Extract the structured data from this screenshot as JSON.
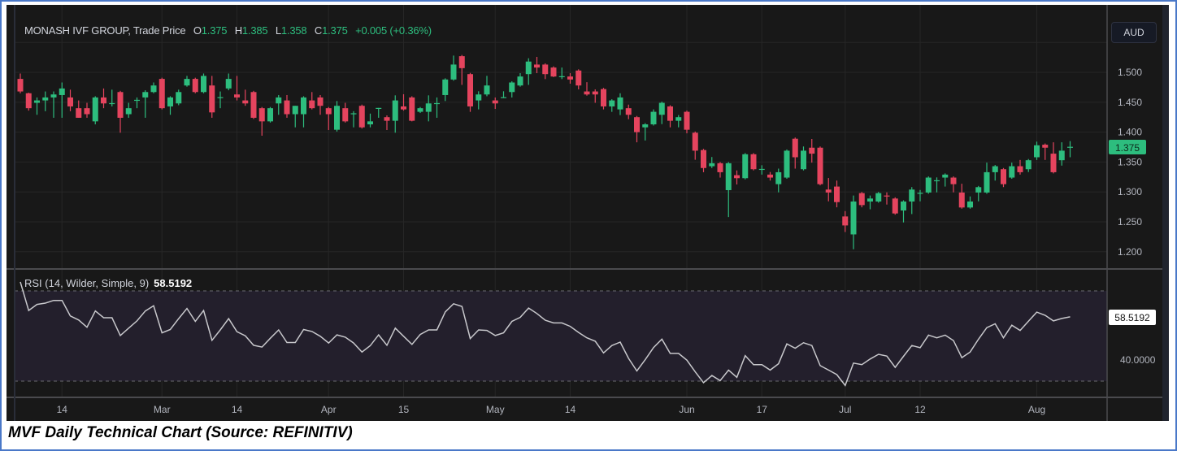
{
  "legend": {
    "symbol": "MONASH IVF GROUP, Trade Price",
    "o_label": "O",
    "o_value": "1.375",
    "h_label": "H",
    "h_value": "1.385",
    "l_label": "L",
    "l_value": "1.358",
    "c_label": "C",
    "c_value": "1.375",
    "change": "+0.005 (+0.36%)"
  },
  "currency_button": "AUD",
  "rsi_legend": {
    "label": "RSI (14, Wilder, Simple, 9)",
    "value": "58.5192"
  },
  "caption": "MVF Daily Technical Chart (Source: REFINITIV)",
  "colors": {
    "up": "#2dbd7e",
    "down": "#e5445e",
    "background": "#181818",
    "rsi_line": "#c8c8cc",
    "rsi_band": "#231f2c"
  },
  "chart_data": [
    {
      "type": "candlestick",
      "title": "MONASH IVF GROUP, Trade Price",
      "ylim": [
        1.16,
        1.56
      ],
      "y_ticks": [
        "1.500",
        "1.450",
        "1.400",
        "1.350",
        "1.300",
        "1.250",
        "1.200"
      ],
      "x_ticks": [
        "14",
        "Mar",
        "14",
        "Apr",
        "15",
        "May",
        "14",
        "Jun",
        "17",
        "Jul",
        "12",
        "Aug"
      ],
      "x_tick_index": [
        5,
        17,
        26,
        37,
        46,
        57,
        66,
        80,
        89,
        99,
        108,
        122
      ],
      "last_price_label": "1.375",
      "ohlc": [
        [
          1.489,
          1.498,
          1.465,
          1.468
        ],
        [
          1.465,
          1.466,
          1.436,
          1.44
        ],
        [
          1.449,
          1.458,
          1.429,
          1.453
        ],
        [
          1.453,
          1.468,
          1.435,
          1.458
        ],
        [
          1.458,
          1.468,
          1.424,
          1.463
        ],
        [
          1.462,
          1.483,
          1.424,
          1.473
        ],
        [
          1.458,
          1.471,
          1.435,
          1.443
        ],
        [
          1.44,
          1.453,
          1.424,
          1.424
        ],
        [
          1.44,
          1.449,
          1.424,
          1.43
        ],
        [
          1.418,
          1.46,
          1.413,
          1.458
        ],
        [
          1.458,
          1.473,
          1.44,
          1.448
        ],
        [
          1.448,
          1.471,
          1.443,
          1.4485
        ],
        [
          1.467,
          1.469,
          1.399,
          1.424
        ],
        [
          1.43,
          1.449,
          1.424,
          1.44
        ],
        [
          1.453,
          1.458,
          1.44,
          1.454
        ],
        [
          1.458,
          1.47,
          1.424,
          1.467
        ],
        [
          1.467,
          1.483,
          1.465,
          1.478
        ],
        [
          1.489,
          1.491,
          1.438,
          1.44
        ],
        [
          1.443,
          1.46,
          1.429,
          1.458
        ],
        [
          1.448,
          1.471,
          1.445,
          1.467
        ],
        [
          1.478,
          1.494,
          1.476,
          1.489
        ],
        [
          1.489,
          1.491,
          1.465,
          1.467
        ],
        [
          1.467,
          1.498,
          1.465,
          1.494
        ],
        [
          1.478,
          1.494,
          1.424,
          1.433
        ],
        [
          1.458,
          1.468,
          1.44,
          1.4585
        ],
        [
          1.473,
          1.498,
          1.47,
          1.489
        ],
        [
          1.463,
          1.494,
          1.453,
          1.458
        ],
        [
          1.453,
          1.471,
          1.444,
          1.448
        ],
        [
          1.467,
          1.469,
          1.422,
          1.424
        ],
        [
          1.44,
          1.442,
          1.394,
          1.418
        ],
        [
          1.418,
          1.442,
          1.416,
          1.44
        ],
        [
          1.448,
          1.462,
          1.429,
          1.458
        ],
        [
          1.453,
          1.462,
          1.424,
          1.43
        ],
        [
          1.43,
          1.444,
          1.408,
          1.444
        ],
        [
          1.43,
          1.46,
          1.408,
          1.458
        ],
        [
          1.453,
          1.467,
          1.438,
          1.44
        ],
        [
          1.458,
          1.462,
          1.429,
          1.444
        ],
        [
          1.44,
          1.442,
          1.4035,
          1.43
        ],
        [
          1.404,
          1.452,
          1.401,
          1.444
        ],
        [
          1.44,
          1.449,
          1.416,
          1.418
        ],
        [
          1.431,
          1.435,
          1.408,
          1.4315
        ],
        [
          1.444,
          1.446,
          1.406,
          1.408
        ],
        [
          1.413,
          1.431,
          1.408,
          1.418
        ],
        [
          1.44,
          1.4405,
          1.424,
          1.4405
        ],
        [
          1.425,
          1.428,
          1.4035,
          1.419
        ],
        [
          1.419,
          1.4615,
          1.399,
          1.453
        ],
        [
          1.443,
          1.4634,
          1.436,
          1.438
        ],
        [
          1.458,
          1.46,
          1.418,
          1.419
        ],
        [
          1.434,
          1.442,
          1.432,
          1.44
        ],
        [
          1.434,
          1.4615,
          1.418,
          1.448
        ],
        [
          1.448,
          1.458,
          1.424,
          1.4485
        ],
        [
          1.462,
          1.49,
          1.452,
          1.488
        ],
        [
          1.488,
          1.528,
          1.486,
          1.513
        ],
        [
          1.527,
          1.529,
          1.479,
          1.507
        ],
        [
          1.497,
          1.499,
          1.4339,
          1.443
        ],
        [
          1.453,
          1.4683,
          1.438,
          1.463
        ],
        [
          1.463,
          1.4941,
          1.46,
          1.478
        ],
        [
          1.453,
          1.4579,
          1.4388,
          1.448
        ],
        [
          1.458,
          1.4683,
          1.457,
          1.4585
        ],
        [
          1.467,
          1.485,
          1.4579,
          1.483
        ],
        [
          1.478,
          1.4986,
          1.476,
          1.493
        ],
        [
          1.497,
          1.5235,
          1.479,
          1.518
        ],
        [
          1.513,
          1.5258,
          1.4986,
          1.508
        ],
        [
          1.513,
          1.515,
          1.4887,
          1.497
        ],
        [
          1.508,
          1.51,
          1.492,
          1.493
        ],
        [
          1.493,
          1.508,
          1.4887,
          1.4935
        ],
        [
          1.493,
          1.4986,
          1.481,
          1.488
        ],
        [
          1.503,
          1.505,
          1.4715,
          1.478
        ],
        [
          1.468,
          1.4835,
          1.461,
          1.463
        ],
        [
          1.468,
          1.4715,
          1.449,
          1.463
        ],
        [
          1.472,
          1.474,
          1.438,
          1.443
        ],
        [
          1.443,
          1.455,
          1.4339,
          1.453
        ],
        [
          1.438,
          1.465,
          1.4285,
          1.458
        ],
        [
          1.44,
          1.446,
          1.4216,
          1.429
        ],
        [
          1.425,
          1.427,
          1.383,
          1.4
        ],
        [
          1.408,
          1.415,
          1.386,
          1.413
        ],
        [
          1.413,
          1.438,
          1.411,
          1.434
        ],
        [
          1.429,
          1.451,
          1.4134,
          1.449
        ],
        [
          1.443,
          1.445,
          1.408,
          1.419
        ],
        [
          1.419,
          1.4285,
          1.408,
          1.425
        ],
        [
          1.434,
          1.436,
          1.398,
          1.404
        ],
        [
          1.399,
          1.401,
          1.3538,
          1.369
        ],
        [
          1.37,
          1.372,
          1.333,
          1.34
        ],
        [
          1.343,
          1.3584,
          1.34,
          1.348
        ],
        [
          1.348,
          1.35,
          1.324,
          1.333
        ],
        [
          1.303,
          1.35,
          1.258,
          1.348
        ],
        [
          1.328,
          1.336,
          1.3125,
          1.323
        ],
        [
          1.323,
          1.365,
          1.321,
          1.363
        ],
        [
          1.363,
          1.365,
          1.336,
          1.338
        ],
        [
          1.338,
          1.3446,
          1.329,
          1.3385
        ],
        [
          1.329,
          1.3333,
          1.319,
          1.324
        ],
        [
          1.313,
          1.339,
          1.2993,
          1.333
        ],
        [
          1.324,
          1.371,
          1.322,
          1.369
        ],
        [
          1.389,
          1.391,
          1.339,
          1.358
        ],
        [
          1.338,
          1.376,
          1.336,
          1.369
        ],
        [
          1.374,
          1.3886,
          1.349,
          1.364
        ],
        [
          1.374,
          1.376,
          1.311,
          1.313
        ],
        [
          1.304,
          1.3233,
          1.2843,
          1.299
        ],
        [
          1.309,
          1.319,
          1.2743,
          1.283
        ],
        [
          1.259,
          1.268,
          1.233,
          1.244
        ],
        [
          1.229,
          1.294,
          1.2042,
          1.284
        ],
        [
          1.298,
          1.3,
          1.2743,
          1.278
        ],
        [
          1.284,
          1.294,
          1.271,
          1.289
        ],
        [
          1.284,
          1.3,
          1.282,
          1.298
        ],
        [
          1.294,
          1.2993,
          1.2789,
          1.2935
        ],
        [
          1.289,
          1.291,
          1.262,
          1.264
        ],
        [
          1.269,
          1.286,
          1.249,
          1.284
        ],
        [
          1.284,
          1.3081,
          1.263,
          1.304
        ],
        [
          1.298,
          1.3033,
          1.2843,
          1.2985
        ],
        [
          1.299,
          1.326,
          1.297,
          1.324
        ],
        [
          1.319,
          1.3243,
          1.2993,
          1.3195
        ],
        [
          1.324,
          1.331,
          1.309,
          1.329
        ],
        [
          1.324,
          1.326,
          1.2993,
          1.313
        ],
        [
          1.299,
          1.3137,
          1.272,
          1.274
        ],
        [
          1.274,
          1.2925,
          1.272,
          1.284
        ],
        [
          1.299,
          1.31,
          1.2843,
          1.308
        ],
        [
          1.299,
          1.349,
          1.297,
          1.333
        ],
        [
          1.333,
          1.345,
          1.319,
          1.343
        ],
        [
          1.338,
          1.34,
          1.3081,
          1.313
        ],
        [
          1.324,
          1.349,
          1.322,
          1.343
        ],
        [
          1.343,
          1.3535,
          1.329,
          1.333
        ],
        [
          1.338,
          1.355,
          1.3333,
          1.353
        ],
        [
          1.358,
          1.3841,
          1.3535,
          1.378
        ],
        [
          1.379,
          1.381,
          1.3535,
          1.374
        ],
        [
          1.364,
          1.383,
          1.331,
          1.333
        ],
        [
          1.353,
          1.383,
          1.344,
          1.369
        ],
        [
          1.375,
          1.385,
          1.358,
          1.3755
        ]
      ]
    },
    {
      "type": "line",
      "title": "RSI (14, Wilder, Simple, 9)",
      "ylim": [
        21,
        82
      ],
      "bands": [
        30,
        70
      ],
      "y_ticks": [
        "40.0000"
      ],
      "last_value_label": "58.5192",
      "values": [
        74,
        61.3,
        64,
        64.6,
        65.8,
        65.8,
        58.9,
        57.1,
        53.9,
        61.1,
        58.1,
        58.1,
        50.2,
        53.5,
        56.7,
        61.1,
        63.4,
        51.4,
        52.9,
        57.7,
        62.2,
        56.5,
        61.3,
        48.1,
        52.7,
        57.7,
        51.9,
        50.1,
        45.9,
        45.1,
        49,
        52.7,
        47.1,
        47.1,
        52.9,
        52,
        49.9,
        46.9,
        50.5,
        49.5,
        46.9,
        42.9,
        45.7,
        50.5,
        45.9,
        53.5,
        49.9,
        46.3,
        50.7,
        52.7,
        52.7,
        60.7,
        64.3,
        63.1,
        48.9,
        52.7,
        52.5,
        50.2,
        51.4,
        56.5,
        58.3,
        62.4,
        60,
        57,
        55.8,
        55.8,
        54.3,
        51.6,
        49.2,
        47.7,
        42.5,
        45.8,
        47.3,
        40.1,
        34.5,
        39.5,
        44.9,
        48.6,
        42.3,
        42.3,
        39.3,
        34.1,
        29.3,
        32.5,
        30.2,
        34.9,
        31.7,
        41.3,
        37.3,
        37.3,
        34.9,
        37.7,
        46.5,
        44.6,
        47,
        45.8,
        36.9,
        34.9,
        32.9,
        28.1,
        38,
        37.3,
        39.8,
        41.9,
        41.1,
        36.1,
        41,
        45.8,
        44.8,
        50.4,
        49.2,
        50.4,
        48,
        40.4,
        42.9,
        48.6,
        53.7,
        55.4,
        49.2,
        54.8,
        52.5,
        56.6,
        60.6,
        59.2,
        56.7,
        57.8,
        58.52
      ]
    }
  ]
}
